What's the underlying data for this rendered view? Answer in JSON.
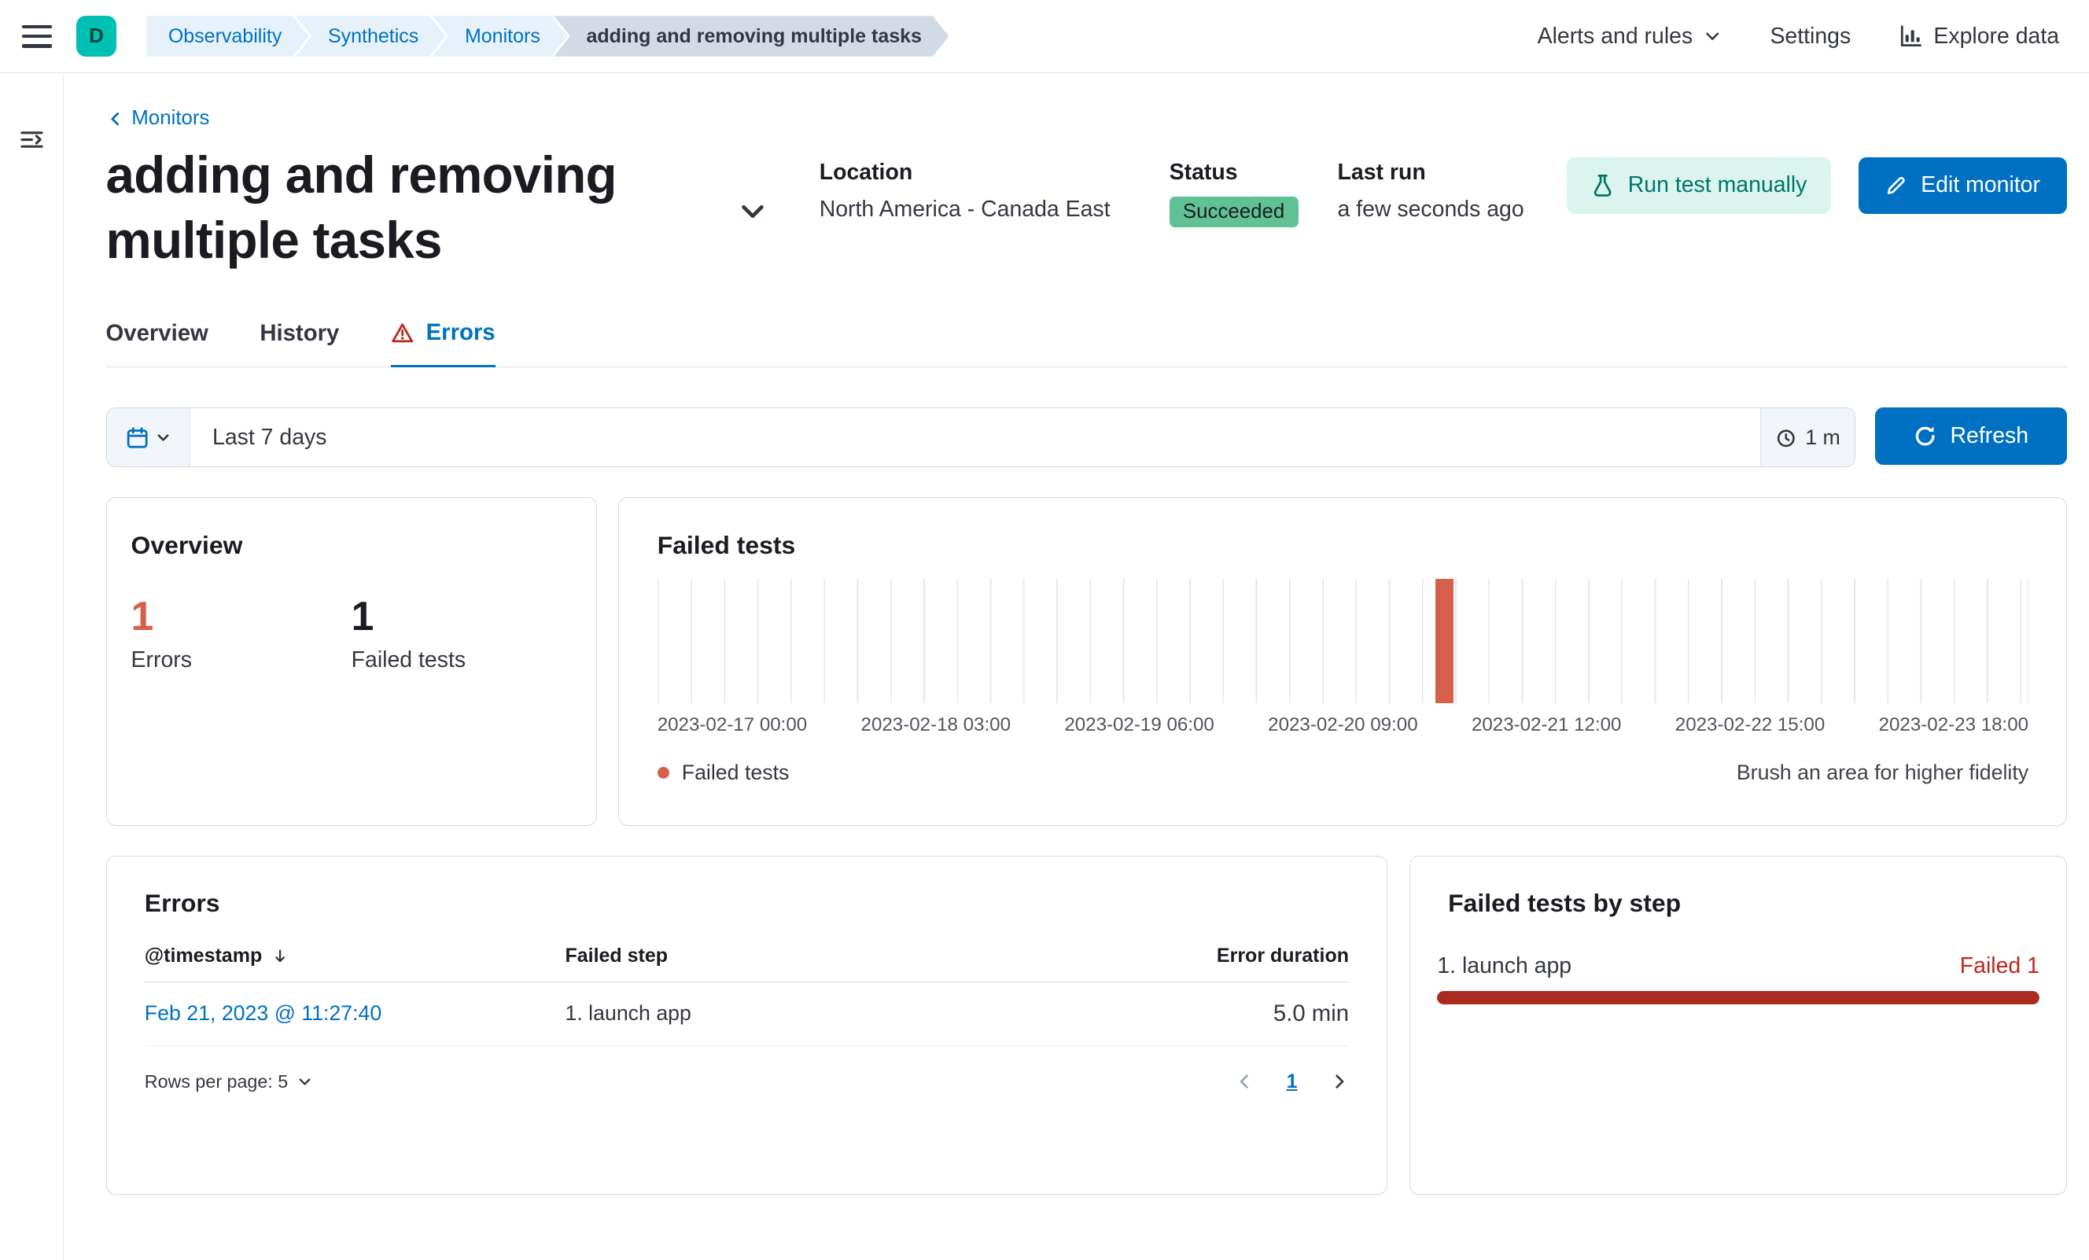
{
  "colors": {
    "primary": "#0071C2",
    "link": "#0071C2",
    "title_text": "#1A1C21",
    "body_text": "#343741",
    "danger_text": "#BD271E",
    "chart_bar_red": "#D6604C",
    "progress_red": "#AB2B20",
    "success_badge_bg": "#5FC195",
    "run_button_bg": "#DBF5EE",
    "run_button_text": "#00756B",
    "border": "#D3DAE6",
    "breadcrumb_blue_bg": "#E6F1FA",
    "breadcrumb_gray_bg": "#D3DAE6",
    "avatar_bg": "#00BFB3"
  },
  "header": {
    "avatar_initial": "D",
    "breadcrumbs": [
      "Observability",
      "Synthetics",
      "Monitors",
      "adding and removing multiple tasks"
    ],
    "nav": {
      "alerts": "Alerts and rules",
      "settings": "Settings",
      "explore": "Explore data"
    }
  },
  "monitor": {
    "back_link": "Monitors",
    "title": "adding and removing multiple tasks",
    "location_label": "Location",
    "location_value": "North America - Canada East",
    "status_label": "Status",
    "status_value": "Succeeded",
    "last_run_label": "Last run",
    "last_run_value": "a few seconds ago",
    "run_test_button": "Run test manually",
    "edit_button": "Edit monitor"
  },
  "tabs": [
    {
      "label": "Overview",
      "active": false
    },
    {
      "label": "History",
      "active": false
    },
    {
      "label": "Errors",
      "active": true
    }
  ],
  "datebar": {
    "range": "Last 7 days",
    "interval": "1 m",
    "refresh": "Refresh"
  },
  "overview_card": {
    "title": "Overview",
    "errors_count": "1",
    "errors_label": "Errors",
    "failed_count": "1",
    "failed_label": "Failed tests"
  },
  "chart_data": {
    "type": "bar",
    "title": "Failed tests",
    "x_ticks": [
      "2023-02-17 00:00",
      "2023-02-18 03:00",
      "2023-02-19 06:00",
      "2023-02-20 09:00",
      "2023-02-21 12:00",
      "2023-02-22 15:00",
      "2023-02-23 18:00"
    ],
    "series": [
      {
        "name": "Failed tests",
        "points": [
          {
            "x": "2023-02-21 11:27",
            "y": 1
          }
        ]
      }
    ],
    "ylim": [
      0,
      1
    ],
    "grid": "vertical",
    "legend": "Failed tests",
    "legend_position": "bottom-left",
    "annotation": "Brush an area for higher fidelity",
    "bar_left_pct": 56.8
  },
  "errors_card": {
    "title": "Errors",
    "columns": [
      "@timestamp",
      "Failed step",
      "Error duration"
    ],
    "rows": [
      {
        "timestamp": "Feb 21, 2023 @ 11:27:40",
        "failed_step": "1. launch app",
        "error_duration": "5.0 min"
      }
    ],
    "rows_per_page": "Rows per page: 5",
    "page": "1"
  },
  "failed_by_step_card": {
    "title": "Failed tests by step",
    "steps": [
      {
        "label": "1. launch app",
        "badge": "Failed 1",
        "fraction": 1
      }
    ]
  }
}
